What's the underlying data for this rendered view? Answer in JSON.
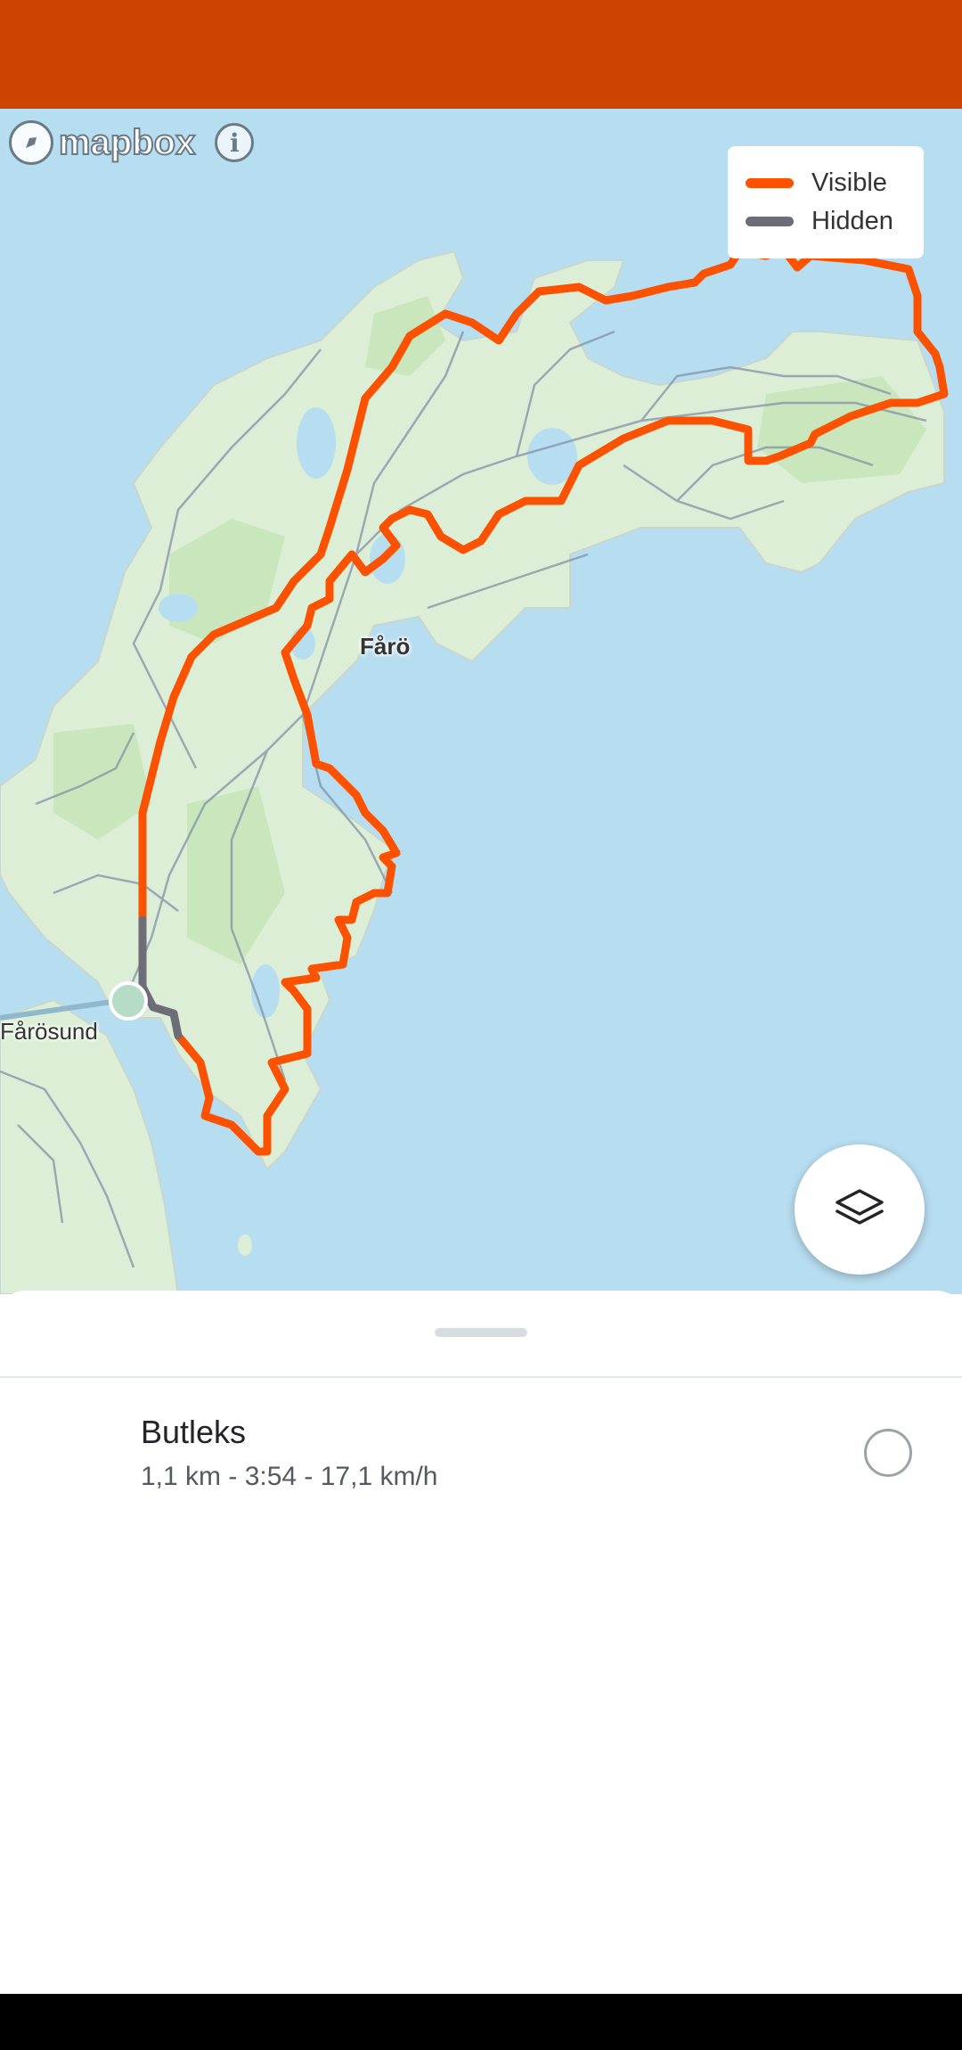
{
  "map": {
    "attribution": "mapbox",
    "info_symbol": "i",
    "legend": {
      "visible_label": "Visible",
      "visible_color": "#fc5200",
      "hidden_label": "Hidden",
      "hidden_color": "#6d6d78"
    },
    "places": {
      "faro": "Fårö",
      "farosund": "Fårösund"
    },
    "layers_icon": "layers-icon"
  },
  "sheet": {
    "activity": {
      "title": "Butleks",
      "stats": "1,1 km - 3:54 - 17,1 km/h",
      "selected": false
    }
  },
  "colors": {
    "status_bar": "#cc4400",
    "water": "#b7ddf0",
    "land": "#dbeed5",
    "route_visible": "#fc5200",
    "route_hidden": "#6d6d78"
  }
}
